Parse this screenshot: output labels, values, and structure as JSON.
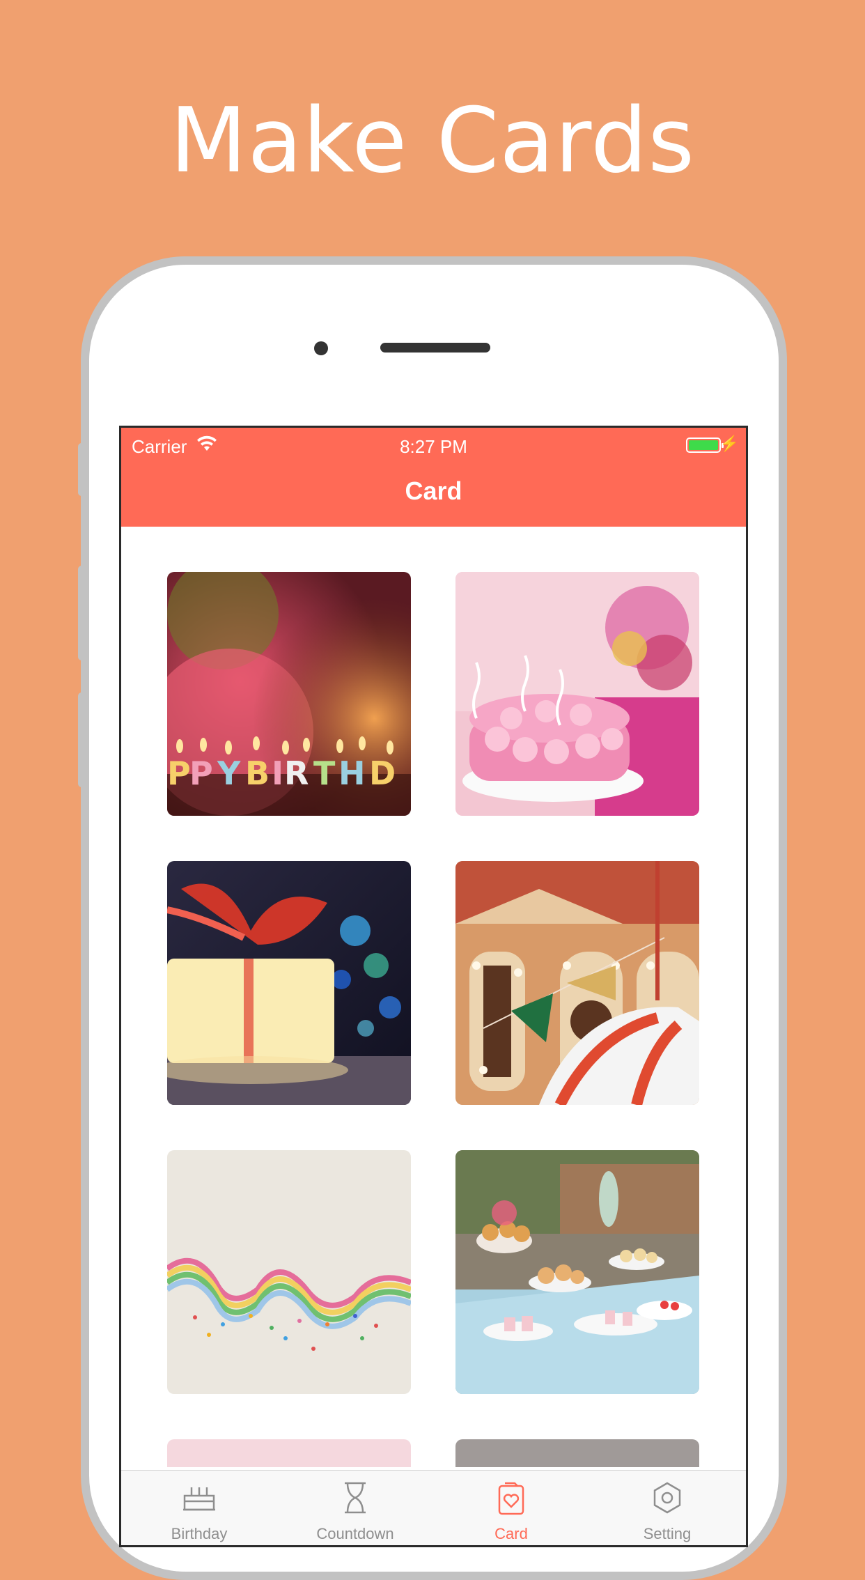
{
  "headline": "Make Cards",
  "status_bar": {
    "carrier": "Carrier",
    "time": "8:27 PM"
  },
  "nav": {
    "title": "Card"
  },
  "cards": [
    {
      "name": "happy-birthday-candles"
    },
    {
      "name": "pink-rose-cake"
    },
    {
      "name": "glowing-gift-box"
    },
    {
      "name": "party-bunting"
    },
    {
      "name": "party-streamers"
    },
    {
      "name": "dessert-table"
    }
  ],
  "tabs": [
    {
      "label": "Birthday",
      "icon": "cake-icon",
      "active": false
    },
    {
      "label": "Countdown",
      "icon": "hourglass-icon",
      "active": false
    },
    {
      "label": "Card",
      "icon": "card-heart-icon",
      "active": true
    },
    {
      "label": "Setting",
      "icon": "gear-icon",
      "active": false
    }
  ],
  "colors": {
    "background": "#F0A06F",
    "accent": "#FF6A56",
    "tab_inactive": "#8e8e8e"
  }
}
